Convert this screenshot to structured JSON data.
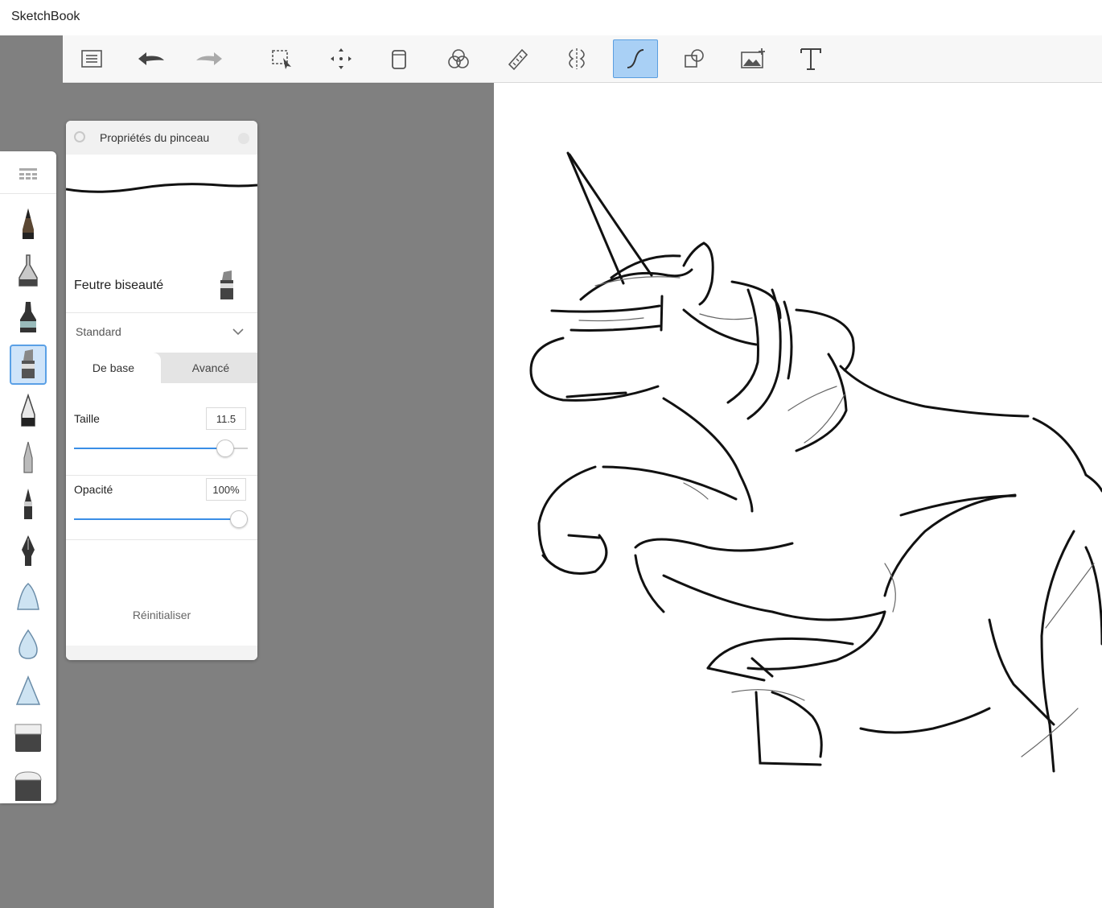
{
  "app": {
    "title": "SketchBook"
  },
  "toolbar": {
    "items": [
      {
        "name": "layers-list-button",
        "icon": "list-icon"
      },
      {
        "name": "undo-button",
        "icon": "undo-arrow-icon"
      },
      {
        "name": "redo-button",
        "icon": "redo-arrow-icon"
      },
      {
        "name": "select-button",
        "icon": "selection-icon"
      },
      {
        "name": "transform-button",
        "icon": "move-icon"
      },
      {
        "name": "fill-button",
        "icon": "bucket-icon"
      },
      {
        "name": "color-editor-button",
        "icon": "color-circles-icon"
      },
      {
        "name": "ruler-button",
        "icon": "ruler-icon"
      },
      {
        "name": "symmetry-button",
        "icon": "symmetry-icon"
      },
      {
        "name": "steady-stroke-button",
        "icon": "curve-stroke-icon",
        "active": true
      },
      {
        "name": "shapes-button",
        "icon": "shapes-icon"
      },
      {
        "name": "image-import-button",
        "icon": "image-add-icon"
      },
      {
        "name": "text-button",
        "icon": "text-icon"
      }
    ]
  },
  "brush_panel": {
    "title": "Propriétés du pinceau",
    "brush_name": "Feutre biseauté",
    "preset": "Standard",
    "tabs": [
      "De base",
      "Avancé"
    ],
    "active_tab": "De base",
    "size": {
      "label": "Taille",
      "value": "11.5",
      "fraction": 0.87
    },
    "opacity": {
      "label": "Opacité",
      "value": "100%",
      "fraction": 1.0
    },
    "reset_label": "Réinitialiser"
  },
  "brush_library": {
    "selected_index": 3,
    "items": [
      "pencil-brush-icon",
      "airbrush-icon",
      "marker-icon",
      "chisel-marker-icon",
      "ballpoint-pen-icon",
      "fineliner-icon",
      "brush-pen-icon",
      "ink-pen-icon",
      "soft-blob-icon",
      "water-drop-icon",
      "cone-brush-icon",
      "eraser-hard-icon",
      "eraser-soft-icon"
    ]
  },
  "colors": {
    "accent": "#3a8ee6",
    "active_bg": "#a9d0f5",
    "workspace": "#808080"
  }
}
